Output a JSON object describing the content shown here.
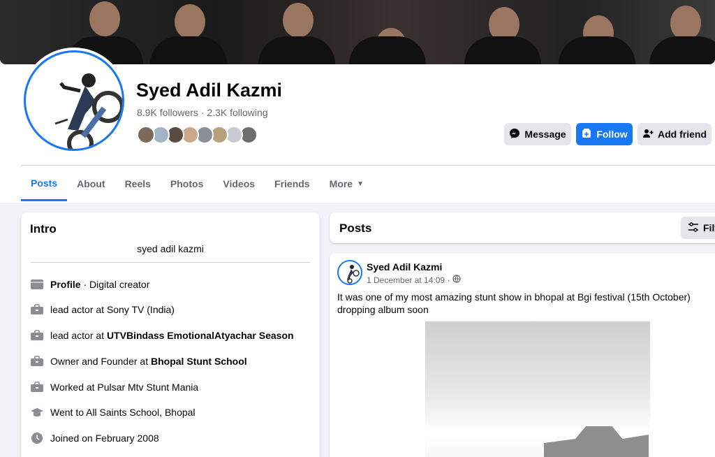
{
  "profile": {
    "name": "Syed Adil Kazmi",
    "followers": "8.9K followers",
    "sep": "·",
    "following": "2.3K following",
    "friend_colors": [
      "#7b6a5a",
      "#a3b4c8",
      "#5a4a3f",
      "#c9a98c",
      "#8a8f96",
      "#b8a17a",
      "#c7cbd1",
      "#6e6e6e"
    ]
  },
  "actions": {
    "message": "Message",
    "follow": "Follow",
    "add_friend": "Add friend"
  },
  "tabs": [
    {
      "label": "Posts",
      "active": true
    },
    {
      "label": "About"
    },
    {
      "label": "Reels"
    },
    {
      "label": "Photos"
    },
    {
      "label": "Videos"
    },
    {
      "label": "Friends"
    },
    {
      "label": "More"
    }
  ],
  "intro": {
    "title": "Intro",
    "bio": "syed adil kazmi",
    "items": [
      {
        "icon": "profile-icon",
        "parts": [
          {
            "b": "Profile"
          },
          {
            "t": " · Digital creator"
          }
        ]
      },
      {
        "icon": "briefcase-icon",
        "parts": [
          {
            "t": "lead actor at Sony TV (India)"
          }
        ]
      },
      {
        "icon": "briefcase-icon",
        "parts": [
          {
            "t": "lead actor at "
          },
          {
            "b": "UTVBindass EmotionalAtyachar Season"
          }
        ]
      },
      {
        "icon": "briefcase-icon",
        "parts": [
          {
            "t": "Owner and Founder at "
          },
          {
            "b": "Bhopal Stunt School"
          }
        ]
      },
      {
        "icon": "briefcase-icon",
        "parts": [
          {
            "t": "Worked at Pulsar Mtv Stunt Mania"
          }
        ]
      },
      {
        "icon": "graduation-cap-icon",
        "parts": [
          {
            "t": "Went to All Saints School, Bhopal"
          }
        ]
      },
      {
        "icon": "clock-icon",
        "parts": [
          {
            "t": "Joined on February 2008"
          }
        ]
      }
    ]
  },
  "posts": {
    "title": "Posts",
    "filter_label": "Filt",
    "author": "Syed Adil Kazmi",
    "date": "1 December at 14:09 ·",
    "text": "It was one of my most amazing stunt show in bhopal at Bgi festival (15th October) dropping album soon"
  },
  "colors": {
    "accent": "#1877f2",
    "muted": "#65676b",
    "bg": "#f0f2f5"
  }
}
